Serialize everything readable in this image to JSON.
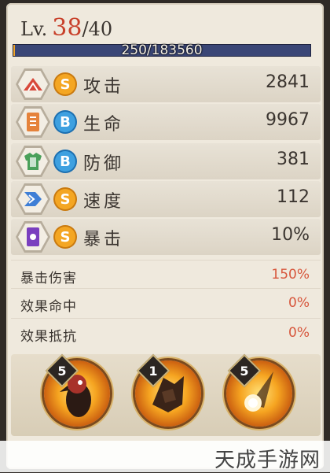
{
  "level": {
    "prefix": "Lv.",
    "current": "38",
    "max": "/40"
  },
  "xp": {
    "text": "250/183560",
    "progress": 0.0014
  },
  "stats": [
    {
      "name": "攻击",
      "grade": "S",
      "value": "2841",
      "icon": "fan-icon",
      "icon_color": "#d8483a"
    },
    {
      "name": "生命",
      "grade": "B",
      "value": "9967",
      "icon": "scroll-icon",
      "icon_color": "#e5823a"
    },
    {
      "name": "防御",
      "grade": "B",
      "value": "381",
      "icon": "armor-icon",
      "icon_color": "#4aa05a"
    },
    {
      "name": "速度",
      "grade": "S",
      "value": "112",
      "icon": "chevron-speed-icon",
      "icon_color": "#3f7fd6"
    },
    {
      "name": "暴击",
      "grade": "S",
      "value": "10%",
      "icon": "charm-icon",
      "icon_color": "#7a3fbf"
    }
  ],
  "sub_stats": [
    {
      "name": "暴击伤害",
      "value": "150%"
    },
    {
      "name": "效果命中",
      "value": "0%"
    },
    {
      "name": "效果抵抗",
      "value": "0%"
    }
  ],
  "skills": [
    {
      "level": "5",
      "icon": "crow-warrior-skill-icon"
    },
    {
      "level": "1",
      "icon": "dark-creature-skill-icon"
    },
    {
      "level": "5",
      "icon": "flaming-orb-skill-icon"
    }
  ],
  "watermark": "天成手游网"
}
